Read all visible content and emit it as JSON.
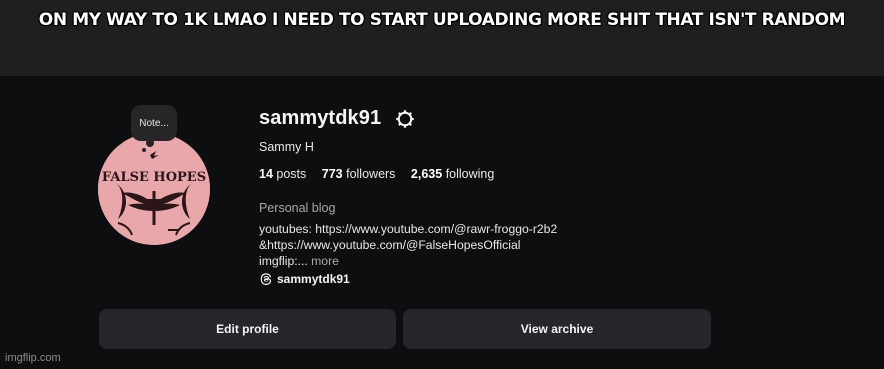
{
  "meme": {
    "caption": "ON MY WAY TO 1K LMAO I NEED TO START UPLOADING MORE SHIT THAT ISN'T RANDOM"
  },
  "profile": {
    "note": "Note...",
    "username": "sammytdk91",
    "full_name": "Sammy H",
    "stats": {
      "posts_count": "14",
      "posts_label": "posts",
      "followers_count": "773",
      "followers_label": "followers",
      "following_count": "2,635",
      "following_label": "following"
    },
    "category": "Personal blog",
    "bio": {
      "line1": "youtubes: https://www.youtube.com/@rawr-froggo-r2b2",
      "line2": "&https://www.youtube.com/@FalseHopesOfficial",
      "line3": "imgflip:...",
      "more": "more"
    },
    "threads_handle": "sammytdk91",
    "avatar_text": "FALSE HOPES",
    "buttons": {
      "edit": "Edit profile",
      "archive": "View archive"
    },
    "icons": {
      "settings": "gear-icon",
      "threads": "threads-icon"
    }
  },
  "watermark": "imgflip.com"
}
